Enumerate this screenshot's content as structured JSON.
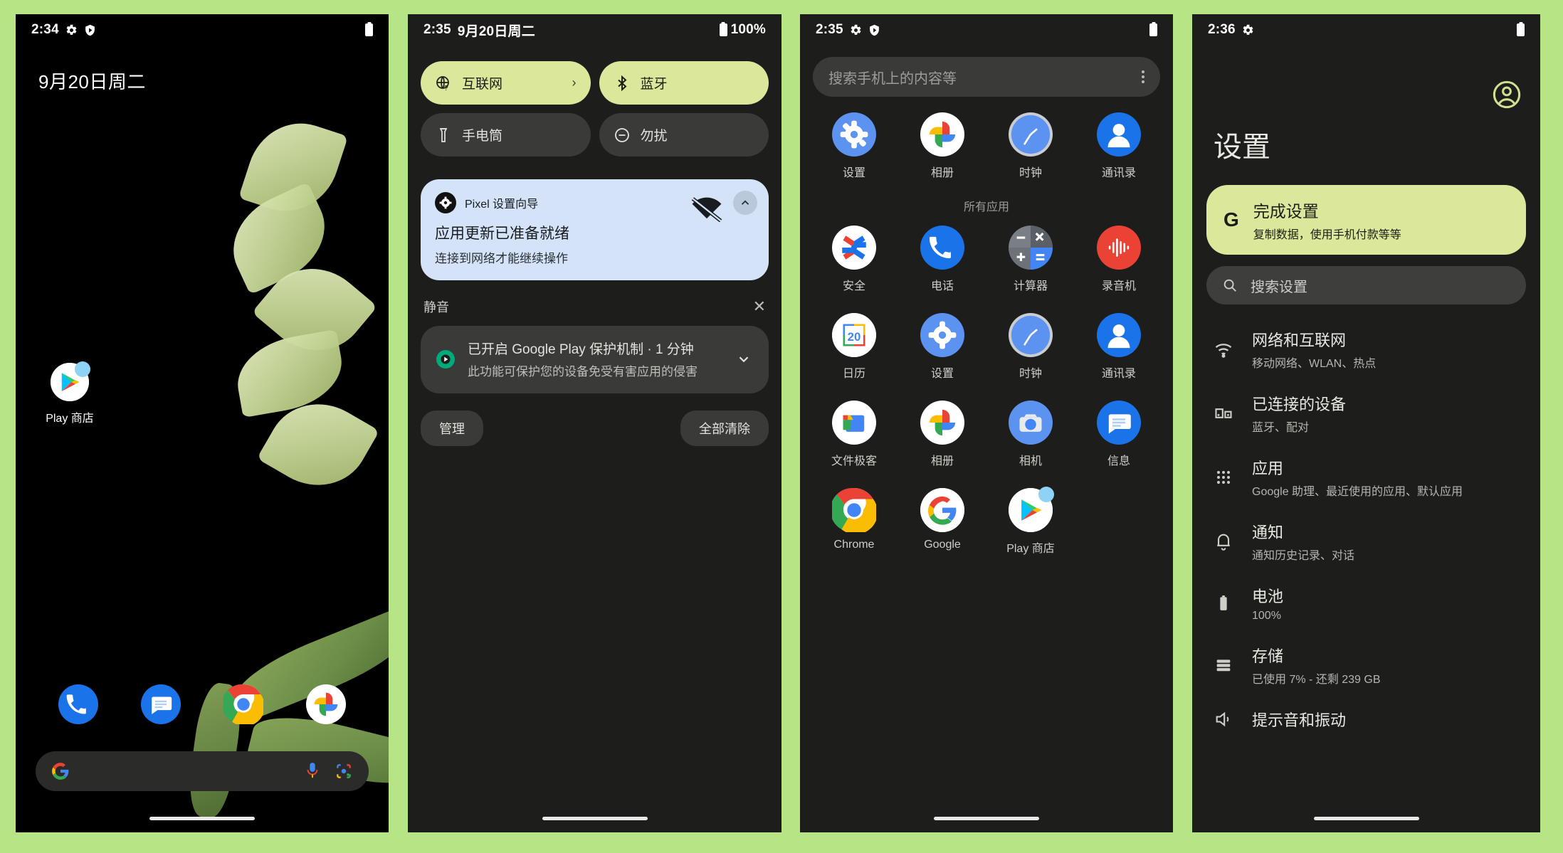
{
  "theme": {
    "page_background": "#b7e485",
    "accent_green": "#dbe89b",
    "panel_dark": "#1d1d1b",
    "notification_blue": "#d4e3f7"
  },
  "phone1": {
    "status": {
      "time": "2:34",
      "icons": [
        "gear-icon",
        "play-protect-icon"
      ],
      "battery": "battery-icon"
    },
    "clock_date": "9月20日周二",
    "home_icon": {
      "label": "Play 商店",
      "icon": "play-store-icon",
      "has_badge": true
    },
    "dock": [
      {
        "label": "电话",
        "icon": "phone-icon"
      },
      {
        "label": "信息",
        "icon": "messages-icon"
      },
      {
        "label": "Chrome",
        "icon": "chrome-icon"
      },
      {
        "label": "相册",
        "icon": "photos-icon"
      }
    ],
    "search": {
      "left_icon": "google-g-icon",
      "mic_icon": "microphone-icon",
      "lens_icon": "google-lens-icon",
      "value": ""
    }
  },
  "phone2": {
    "status": {
      "time": "2:35",
      "date": "9月20日周二",
      "battery_pct": "100%"
    },
    "tiles": [
      {
        "label": "互联网",
        "icon": "internet-globe-icon",
        "state": "on",
        "chevron": "›"
      },
      {
        "label": "蓝牙",
        "icon": "bluetooth-icon",
        "state": "on",
        "chevron": ""
      },
      {
        "label": "手电筒",
        "icon": "flashlight-icon",
        "state": "off",
        "chevron": ""
      },
      {
        "label": "勿扰",
        "icon": "do-not-disturb-icon",
        "state": "off",
        "chevron": ""
      }
    ],
    "notifications": [
      {
        "app": "Pixel 设置向导",
        "app_icon": "setup-wizard-icon",
        "title": "应用更新已准备就绪",
        "body": "连接到网络才能继续操作",
        "status_icon": "wifi-off-icon",
        "expand_icon": "chevron-up-icon",
        "style": "blue"
      }
    ],
    "silent_section": {
      "label": "静音",
      "close_icon": "close-icon"
    },
    "silent_notifications": [
      {
        "title": "已开启 Google Play 保护机制 · 1 分钟",
        "body": "此功能可保护您的设备免受有害应用的侵害",
        "app_icon": "play-protect-icon",
        "expand_icon": "chevron-down-icon",
        "style": "dark"
      }
    ],
    "actions": {
      "manage": "管理",
      "clear_all": "全部清除"
    }
  },
  "phone3": {
    "status": {
      "time": "2:35",
      "icons": [
        "gear-icon",
        "play-protect-icon"
      ],
      "battery": "battery-icon"
    },
    "search": {
      "placeholder": "搜索手机上的内容等",
      "overflow_icon": "more-vertical-icon"
    },
    "predicted_apps": [
      {
        "label": "设置",
        "icon": "settings-gear-icon"
      },
      {
        "label": "相册",
        "icon": "photos-icon"
      },
      {
        "label": "时钟",
        "icon": "clock-icon"
      },
      {
        "label": "通讯录",
        "icon": "contacts-icon"
      }
    ],
    "all_apps_label": "所有应用",
    "apps": [
      {
        "label": "安全",
        "icon": "safety-icon"
      },
      {
        "label": "电话",
        "icon": "phone-icon"
      },
      {
        "label": "计算器",
        "icon": "calculator-icon"
      },
      {
        "label": "录音机",
        "icon": "recorder-icon"
      },
      {
        "label": "日历",
        "icon": "calendar-icon",
        "day": "20"
      },
      {
        "label": "设置",
        "icon": "settings-gear-icon"
      },
      {
        "label": "时钟",
        "icon": "clock-icon"
      },
      {
        "label": "通讯录",
        "icon": "contacts-icon"
      },
      {
        "label": "文件极客",
        "icon": "files-icon"
      },
      {
        "label": "相册",
        "icon": "photos-icon"
      },
      {
        "label": "相机",
        "icon": "camera-icon"
      },
      {
        "label": "信息",
        "icon": "messages-icon"
      },
      {
        "label": "Chrome",
        "icon": "chrome-icon"
      },
      {
        "label": "Google",
        "icon": "google-g-icon"
      },
      {
        "label": "Play 商店",
        "icon": "play-store-icon",
        "has_badge": true
      }
    ]
  },
  "phone4": {
    "status": {
      "time": "2:36",
      "icons": [
        "gear-icon"
      ],
      "battery": "battery-icon"
    },
    "avatar_icon": "account-circle-icon",
    "title": "设置",
    "suggestion": {
      "brand": "G",
      "title": "完成设置",
      "subtitle": "复制数据，使用手机付款等等"
    },
    "search": {
      "placeholder": "搜索设置",
      "icon": "search-icon"
    },
    "items": [
      {
        "title": "网络和互联网",
        "subtitle": "移动网络、WLAN、热点",
        "icon": "wifi-icon"
      },
      {
        "title": "已连接的设备",
        "subtitle": "蓝牙、配对",
        "icon": "connected-devices-icon"
      },
      {
        "title": "应用",
        "subtitle": "Google 助理、最近使用的应用、默认应用",
        "icon": "apps-grid-icon"
      },
      {
        "title": "通知",
        "subtitle": "通知历史记录、对话",
        "icon": "bell-icon"
      },
      {
        "title": "电池",
        "subtitle": "100%",
        "icon": "battery-icon"
      },
      {
        "title": "存储",
        "subtitle": "已使用 7% - 还剩 239 GB",
        "icon": "storage-icon"
      },
      {
        "title": "提示音和振动",
        "subtitle": "",
        "icon": "sound-icon"
      }
    ]
  }
}
